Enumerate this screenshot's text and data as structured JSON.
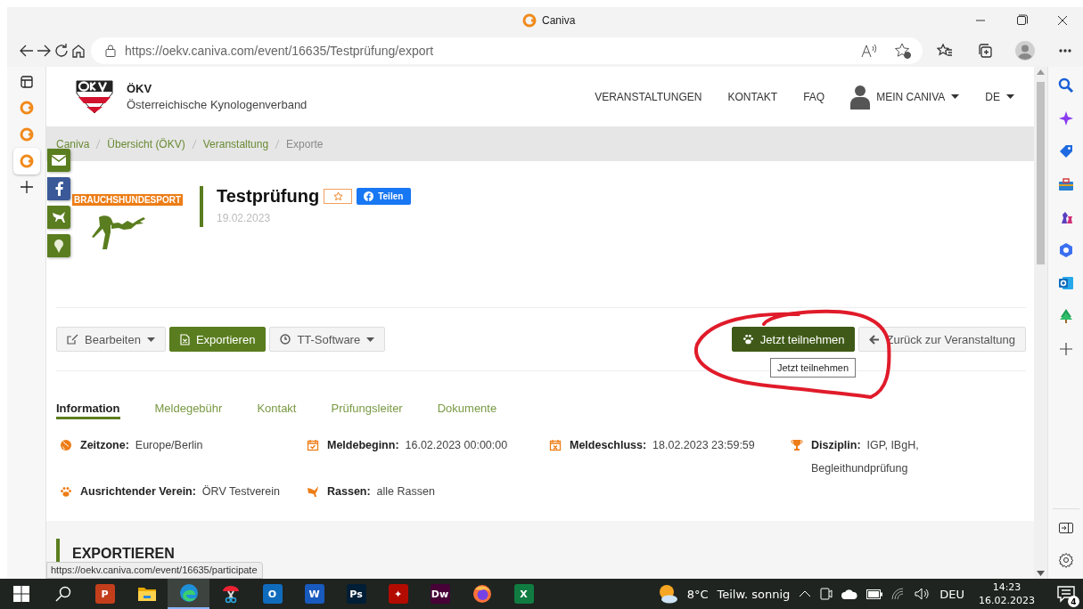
{
  "window": {
    "title": "Caniva",
    "address": "https://oekv.caniva.com/event/16635/Testprüfung/export"
  },
  "site_header": {
    "brand_abbr": "ÖKV",
    "brand_name": "Österreichische Kynologenverband",
    "nav": [
      "VERANSTALTUNGEN",
      "KONTAKT",
      "FAQ"
    ],
    "account": "MEIN CANIVA",
    "language": "DE"
  },
  "breadcrumb": [
    {
      "label": "Caniva",
      "current": false
    },
    {
      "label": "Übersicht (ÖKV)",
      "current": false
    },
    {
      "label": "Veranstaltung",
      "current": false
    },
    {
      "label": "Exporte",
      "current": true
    }
  ],
  "event": {
    "category": "BRAUCHSHUNDESPORT",
    "title": "Testprüfung",
    "date": "19.02.2023",
    "share": "Teilen"
  },
  "actions": [
    {
      "label": "Bearbeiten",
      "kind": "edit"
    },
    {
      "label": "Exportieren",
      "kind": "export"
    },
    {
      "label": "TT-Software",
      "kind": "software"
    }
  ],
  "participate": {
    "label": "Jetzt teilnehmen",
    "tooltip": "Jetzt teilnehmen"
  },
  "back": {
    "label": "Zurück zur Veranstaltung"
  },
  "tabs": [
    {
      "label": "Information",
      "selected": true
    },
    {
      "label": "Meldegebühr",
      "selected": false
    },
    {
      "label": "Kontakt",
      "selected": false
    },
    {
      "label": "Prüfungsleiter",
      "selected": false
    },
    {
      "label": "Dokumente",
      "selected": false
    }
  ],
  "info": [
    {
      "kind": "globe",
      "label": "Zeitzone:",
      "value": "Europe/Berlin"
    },
    {
      "kind": "calendar-check",
      "label": "Meldebeginn:",
      "value": "16.02.2023 00:00:00"
    },
    {
      "kind": "calendar-x",
      "label": "Meldeschluss:",
      "value": "18.02.2023 23:59:59"
    },
    {
      "kind": "trophy",
      "label": "Disziplin:",
      "value": "IGP, IBgH, Begleithundprüfung"
    },
    {
      "kind": "paw",
      "label": "Ausrichtender Verein:",
      "value": "ÖRV Testverein"
    },
    {
      "kind": "dog",
      "label": "Rassen:",
      "value": "alle Rassen"
    }
  ],
  "section_title": "EXPORTIEREN",
  "status_url": "https://oekv.caniva.com/event/16635/participate",
  "taskbar": {
    "apps": [
      {
        "kind": "start"
      },
      {
        "kind": "search"
      },
      {
        "kind": "tile",
        "color": "#c43e1c",
        "glyph": "P",
        "selected": false
      },
      {
        "kind": "folder",
        "selected": false
      },
      {
        "kind": "edge",
        "selected": true
      },
      {
        "kind": "scissors",
        "selected": false
      },
      {
        "kind": "tile",
        "color": "#0f6cbd",
        "glyph": "O",
        "selected": false
      },
      {
        "kind": "tile",
        "color": "#185abd",
        "glyph": "W",
        "selected": false
      },
      {
        "kind": "tile",
        "color": "#001e36",
        "glyph": "Ps",
        "selected": false
      },
      {
        "kind": "tile",
        "color": "#b30b00",
        "glyph": "✦",
        "selected": false
      },
      {
        "kind": "tile",
        "color": "#470137",
        "glyph": "Dw",
        "selected": false
      },
      {
        "kind": "firefox",
        "selected": false
      },
      {
        "kind": "tile",
        "color": "#107c41",
        "glyph": "X",
        "selected": false
      }
    ],
    "temperature": "8°C",
    "weather": "Teilw. sonnig",
    "language": "DEU",
    "time": "14:23",
    "date": "16.02.2023",
    "notifications": "4"
  }
}
